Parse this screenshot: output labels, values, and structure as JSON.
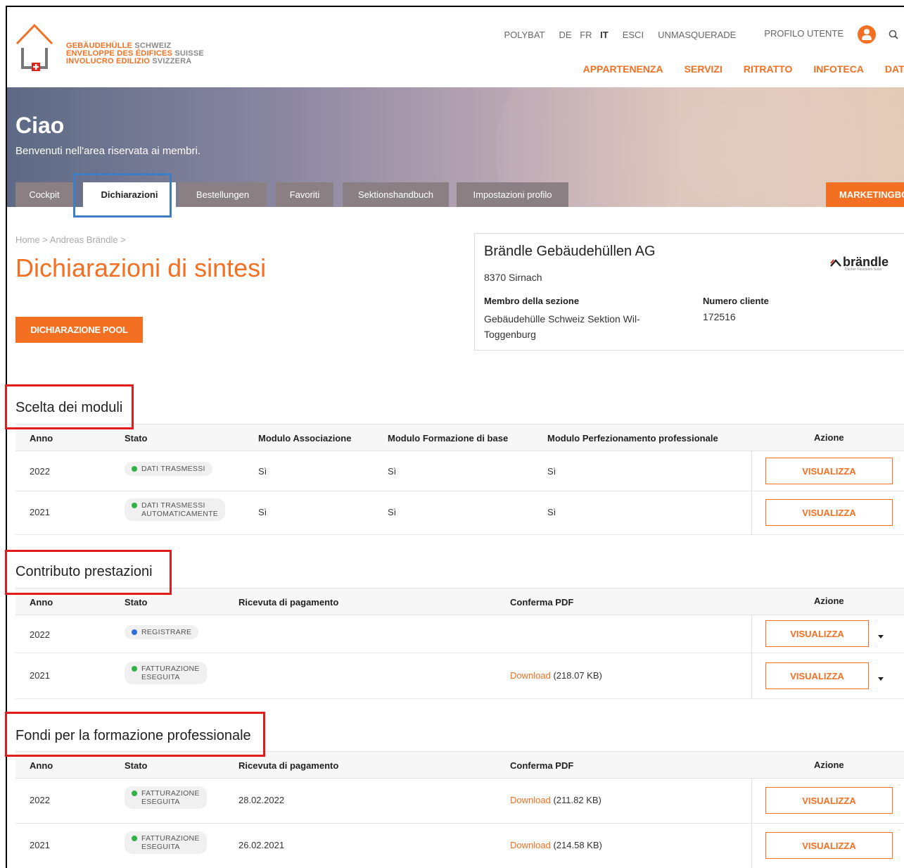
{
  "header": {
    "logo_lines": [
      {
        "bold": "GEBÄUDEHÜLLE",
        "rest": "SCHWEIZ"
      },
      {
        "bold": "ENVELOPPE DES ÉDIFICES",
        "rest": "SUISSE"
      },
      {
        "bold": "INVOLUCRO EDILIZIO",
        "rest": "SVIZZERA"
      }
    ],
    "top_links": {
      "polybat": "POLYBAT",
      "lang_de": "DE",
      "lang_fr": "FR",
      "lang_it": "IT",
      "esci": "ESCI",
      "unmasquerade": "UNMASQUERADE",
      "profile": "PROFILO UTENTE"
    },
    "main_nav": [
      "APPARTENENZA",
      "SERVIZI",
      "RITRATTO",
      "INFOTECA",
      "DATE"
    ],
    "accent_color": "#f36f21"
  },
  "hero": {
    "title": "Ciao",
    "subtitle": "Benvenuti nell'area riservata ai membri.",
    "tabs": [
      "Cockpit",
      "Dichiarazioni",
      "Bestellungen",
      "Favoriti",
      "Sektionshandbuch",
      "Impostazioni profilo"
    ],
    "active_tab": "Dichiarazioni",
    "marketing_tab": "MARKETINGBOX"
  },
  "breadcrumb": "Home >  Andreas Brändle >",
  "page_title": "Dichiarazioni di sintesi",
  "pool_button": "DICHIARAZIONE POOL",
  "company": {
    "name": "Brändle Gebäudehüllen AG",
    "city": "8370 Sirnach",
    "section_label": "Membro della sezione",
    "section_value": "Gebäudehülle Schweiz Sektion Wil-Toggenburg",
    "customer_label": "Numero cliente",
    "customer_value": "172516",
    "brand_name": "brändle",
    "brand_tagline": "Dächer Fassaden Solar"
  },
  "section_moduli": {
    "title": "Scelta dei moduli",
    "headers": [
      "Anno",
      "Stato",
      "Modulo Associazione",
      "Modulo Formazione di base",
      "Modulo Perfezionamento professionale",
      "Azione"
    ],
    "rows": [
      {
        "anno": "2022",
        "stato": "DATI TRASMESSI",
        "assoc": "Sì",
        "base": "Sì",
        "perf": "Sì",
        "azione": "VISUALIZZA"
      },
      {
        "anno": "2021",
        "stato_l1": "DATI TRASMESSI",
        "stato_l2": "AUTOMATICAMENTE",
        "assoc": "Sì",
        "base": "Sì",
        "perf": "Sì",
        "azione": "VISUALIZZA"
      }
    ]
  },
  "section_contributo": {
    "title": "Contributo prestazioni",
    "headers": [
      "Anno",
      "Stato",
      "Ricevuta di pagamento",
      "Conferma PDF",
      "Azione"
    ],
    "rows": [
      {
        "anno": "2022",
        "stato": "REGISTRARE",
        "ricevuta": "",
        "pdf_link": "",
        "pdf_size": "",
        "azione": "VISUALIZZA"
      },
      {
        "anno": "2021",
        "stato_l1": "FATTURAZIONE",
        "stato_l2": "ESEGUITA",
        "ricevuta": "",
        "pdf_link": "Download",
        "pdf_size": "(218.07 KB)",
        "azione": "VISUALIZZA"
      }
    ]
  },
  "section_fondi": {
    "title": "Fondi per la formazione professionale",
    "headers": [
      "Anno",
      "Stato",
      "Ricevuta di pagamento",
      "Conferma PDF",
      "Azione"
    ],
    "rows": [
      {
        "anno": "2022",
        "stato_l1": "FATTURAZIONE",
        "stato_l2": "ESEGUITA",
        "ricevuta": "28.02.2022",
        "pdf_link": "Download",
        "pdf_size": "(211.82 KB)",
        "azione": "VISUALIZZA"
      },
      {
        "anno": "2021",
        "stato_l1": "FATTURAZIONE",
        "stato_l2": "ESEGUITA",
        "ricevuta": "26.02.2021",
        "pdf_link": "Download",
        "pdf_size": "(214.58 KB)",
        "azione": "VISUALIZZA"
      }
    ]
  }
}
